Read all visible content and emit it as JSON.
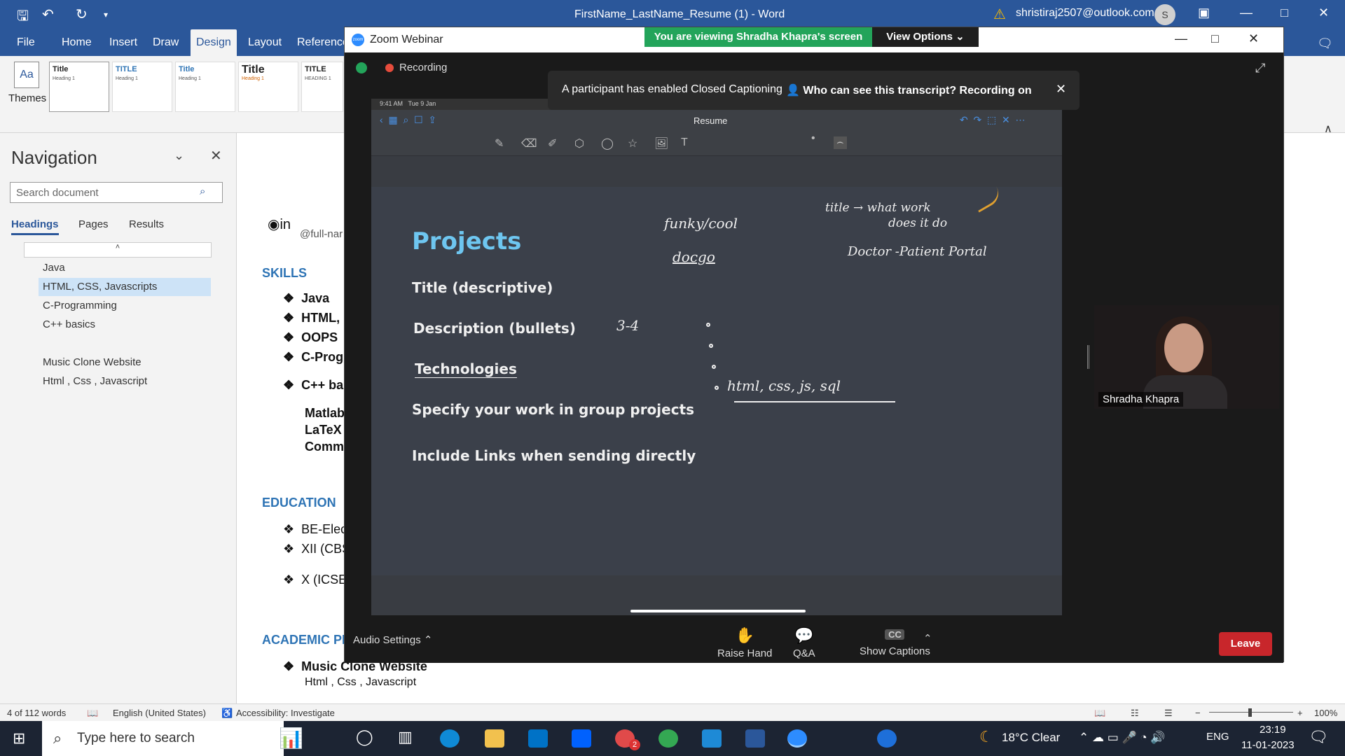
{
  "word": {
    "title": "FirstName_LastName_Resume (1)  -  Word",
    "account": "shristiraj2507@outlook.com",
    "avatar": "S",
    "tabs": [
      "File",
      "Home",
      "Insert",
      "Draw",
      "Design",
      "Layout",
      "Reference"
    ],
    "selected_tab": "Design",
    "themes_label": "Themes",
    "style_gallery": [
      {
        "name": "Title",
        "heading": "Heading 1"
      },
      {
        "name": "TITLE",
        "heading": "Heading 1"
      },
      {
        "name": "Title",
        "heading": "Heading 1"
      },
      {
        "name": "Title",
        "heading": "Heading 1"
      },
      {
        "name": "TITLE",
        "heading": "HEADING 1"
      }
    ],
    "navigation": {
      "title": "Navigation",
      "search_placeholder": "Search document",
      "tabs": [
        "Headings",
        "Pages",
        "Results"
      ],
      "items": [
        "Java",
        "HTML, CSS, Javascripts",
        "C-Programming",
        "C++ basics",
        "Music Clone Website",
        "Html , Css  , Javascript"
      ],
      "selected_item": "HTML, CSS, Javascripts"
    },
    "doc": {
      "handle": "@full-nar",
      "skills_heading": "SKILLS",
      "skills": [
        "Java",
        "HTML,",
        "OOPS",
        "C-Prog",
        "C++ ba"
      ],
      "other_skills": [
        "Matlab",
        "LaTeX",
        "Comm"
      ],
      "education_heading": "EDUCATION",
      "education": [
        "BE-Elec",
        "XII (CBS",
        "X (ICSE"
      ],
      "academic_heading": "ACADEMIC PR",
      "academic_item": "Music Clone Website",
      "academic_sub": "Html , Css  , Javascript"
    },
    "status": {
      "words": "4 of 112 words",
      "language": "English (United States)",
      "accessibility": "Accessibility: Investigate",
      "zoom": "100%"
    }
  },
  "zoom": {
    "title": "Zoom Webinar",
    "viewing": "You are viewing Shradha Khapra's screen",
    "view_options": "View Options",
    "recording": "Recording",
    "cc_notice": "A participant has enabled Closed Captioning",
    "cc_who": "Who can see this transcript? Recording on",
    "speaker": "Shradha Khapra",
    "audio_settings": "Audio Settings",
    "raise_hand": "Raise Hand",
    "qa": "Q&A",
    "show_captions": "Show Captions",
    "cc_badge": "CC",
    "leave": "Leave"
  },
  "ipad": {
    "time": "9:41 AM",
    "date": "Tue 9 Jan",
    "doc_name": "Resume",
    "slide": {
      "title": "Projects",
      "lines": [
        "Title (descriptive)",
        "Description (bullets)",
        "Technologies",
        "Specify your work in group projects",
        "Include Links when sending directly"
      ],
      "handwriting": [
        "funky/cool",
        "docgo",
        "title → what work",
        "does it do",
        "Doctor -Patient Portal",
        "3-4",
        "html, css, js, sql"
      ]
    }
  },
  "taskbar": {
    "search_placeholder": "Type here to search",
    "weather": "18°C  Clear",
    "lang": "ENG",
    "time": "23:19",
    "date": "11-01-2023",
    "badge": "2"
  }
}
